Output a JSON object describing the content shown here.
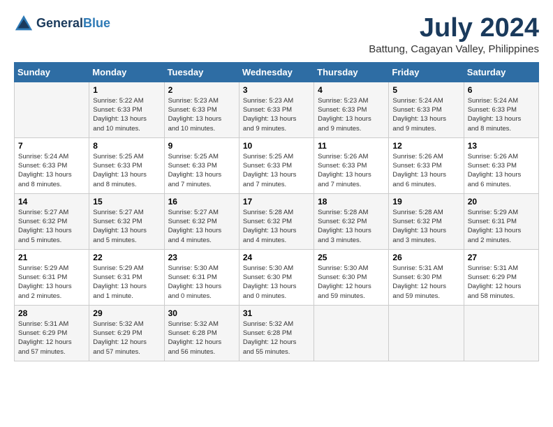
{
  "logo": {
    "line1": "General",
    "line2": "Blue"
  },
  "title": "July 2024",
  "subtitle": "Battung, Cagayan Valley, Philippines",
  "weekdays": [
    "Sunday",
    "Monday",
    "Tuesday",
    "Wednesday",
    "Thursday",
    "Friday",
    "Saturday"
  ],
  "weeks": [
    [
      {
        "day": "",
        "info": ""
      },
      {
        "day": "1",
        "info": "Sunrise: 5:22 AM\nSunset: 6:33 PM\nDaylight: 13 hours\nand 10 minutes."
      },
      {
        "day": "2",
        "info": "Sunrise: 5:23 AM\nSunset: 6:33 PM\nDaylight: 13 hours\nand 10 minutes."
      },
      {
        "day": "3",
        "info": "Sunrise: 5:23 AM\nSunset: 6:33 PM\nDaylight: 13 hours\nand 9 minutes."
      },
      {
        "day": "4",
        "info": "Sunrise: 5:23 AM\nSunset: 6:33 PM\nDaylight: 13 hours\nand 9 minutes."
      },
      {
        "day": "5",
        "info": "Sunrise: 5:24 AM\nSunset: 6:33 PM\nDaylight: 13 hours\nand 9 minutes."
      },
      {
        "day": "6",
        "info": "Sunrise: 5:24 AM\nSunset: 6:33 PM\nDaylight: 13 hours\nand 8 minutes."
      }
    ],
    [
      {
        "day": "7",
        "info": "Sunrise: 5:24 AM\nSunset: 6:33 PM\nDaylight: 13 hours\nand 8 minutes."
      },
      {
        "day": "8",
        "info": "Sunrise: 5:25 AM\nSunset: 6:33 PM\nDaylight: 13 hours\nand 8 minutes."
      },
      {
        "day": "9",
        "info": "Sunrise: 5:25 AM\nSunset: 6:33 PM\nDaylight: 13 hours\nand 7 minutes."
      },
      {
        "day": "10",
        "info": "Sunrise: 5:25 AM\nSunset: 6:33 PM\nDaylight: 13 hours\nand 7 minutes."
      },
      {
        "day": "11",
        "info": "Sunrise: 5:26 AM\nSunset: 6:33 PM\nDaylight: 13 hours\nand 7 minutes."
      },
      {
        "day": "12",
        "info": "Sunrise: 5:26 AM\nSunset: 6:33 PM\nDaylight: 13 hours\nand 6 minutes."
      },
      {
        "day": "13",
        "info": "Sunrise: 5:26 AM\nSunset: 6:33 PM\nDaylight: 13 hours\nand 6 minutes."
      }
    ],
    [
      {
        "day": "14",
        "info": "Sunrise: 5:27 AM\nSunset: 6:32 PM\nDaylight: 13 hours\nand 5 minutes."
      },
      {
        "day": "15",
        "info": "Sunrise: 5:27 AM\nSunset: 6:32 PM\nDaylight: 13 hours\nand 5 minutes."
      },
      {
        "day": "16",
        "info": "Sunrise: 5:27 AM\nSunset: 6:32 PM\nDaylight: 13 hours\nand 4 minutes."
      },
      {
        "day": "17",
        "info": "Sunrise: 5:28 AM\nSunset: 6:32 PM\nDaylight: 13 hours\nand 4 minutes."
      },
      {
        "day": "18",
        "info": "Sunrise: 5:28 AM\nSunset: 6:32 PM\nDaylight: 13 hours\nand 3 minutes."
      },
      {
        "day": "19",
        "info": "Sunrise: 5:28 AM\nSunset: 6:32 PM\nDaylight: 13 hours\nand 3 minutes."
      },
      {
        "day": "20",
        "info": "Sunrise: 5:29 AM\nSunset: 6:31 PM\nDaylight: 13 hours\nand 2 minutes."
      }
    ],
    [
      {
        "day": "21",
        "info": "Sunrise: 5:29 AM\nSunset: 6:31 PM\nDaylight: 13 hours\nand 2 minutes."
      },
      {
        "day": "22",
        "info": "Sunrise: 5:29 AM\nSunset: 6:31 PM\nDaylight: 13 hours\nand 1 minute."
      },
      {
        "day": "23",
        "info": "Sunrise: 5:30 AM\nSunset: 6:31 PM\nDaylight: 13 hours\nand 0 minutes."
      },
      {
        "day": "24",
        "info": "Sunrise: 5:30 AM\nSunset: 6:30 PM\nDaylight: 13 hours\nand 0 minutes."
      },
      {
        "day": "25",
        "info": "Sunrise: 5:30 AM\nSunset: 6:30 PM\nDaylight: 12 hours\nand 59 minutes."
      },
      {
        "day": "26",
        "info": "Sunrise: 5:31 AM\nSunset: 6:30 PM\nDaylight: 12 hours\nand 59 minutes."
      },
      {
        "day": "27",
        "info": "Sunrise: 5:31 AM\nSunset: 6:29 PM\nDaylight: 12 hours\nand 58 minutes."
      }
    ],
    [
      {
        "day": "28",
        "info": "Sunrise: 5:31 AM\nSunset: 6:29 PM\nDaylight: 12 hours\nand 57 minutes."
      },
      {
        "day": "29",
        "info": "Sunrise: 5:32 AM\nSunset: 6:29 PM\nDaylight: 12 hours\nand 57 minutes."
      },
      {
        "day": "30",
        "info": "Sunrise: 5:32 AM\nSunset: 6:28 PM\nDaylight: 12 hours\nand 56 minutes."
      },
      {
        "day": "31",
        "info": "Sunrise: 5:32 AM\nSunset: 6:28 PM\nDaylight: 12 hours\nand 55 minutes."
      },
      {
        "day": "",
        "info": ""
      },
      {
        "day": "",
        "info": ""
      },
      {
        "day": "",
        "info": ""
      }
    ]
  ]
}
